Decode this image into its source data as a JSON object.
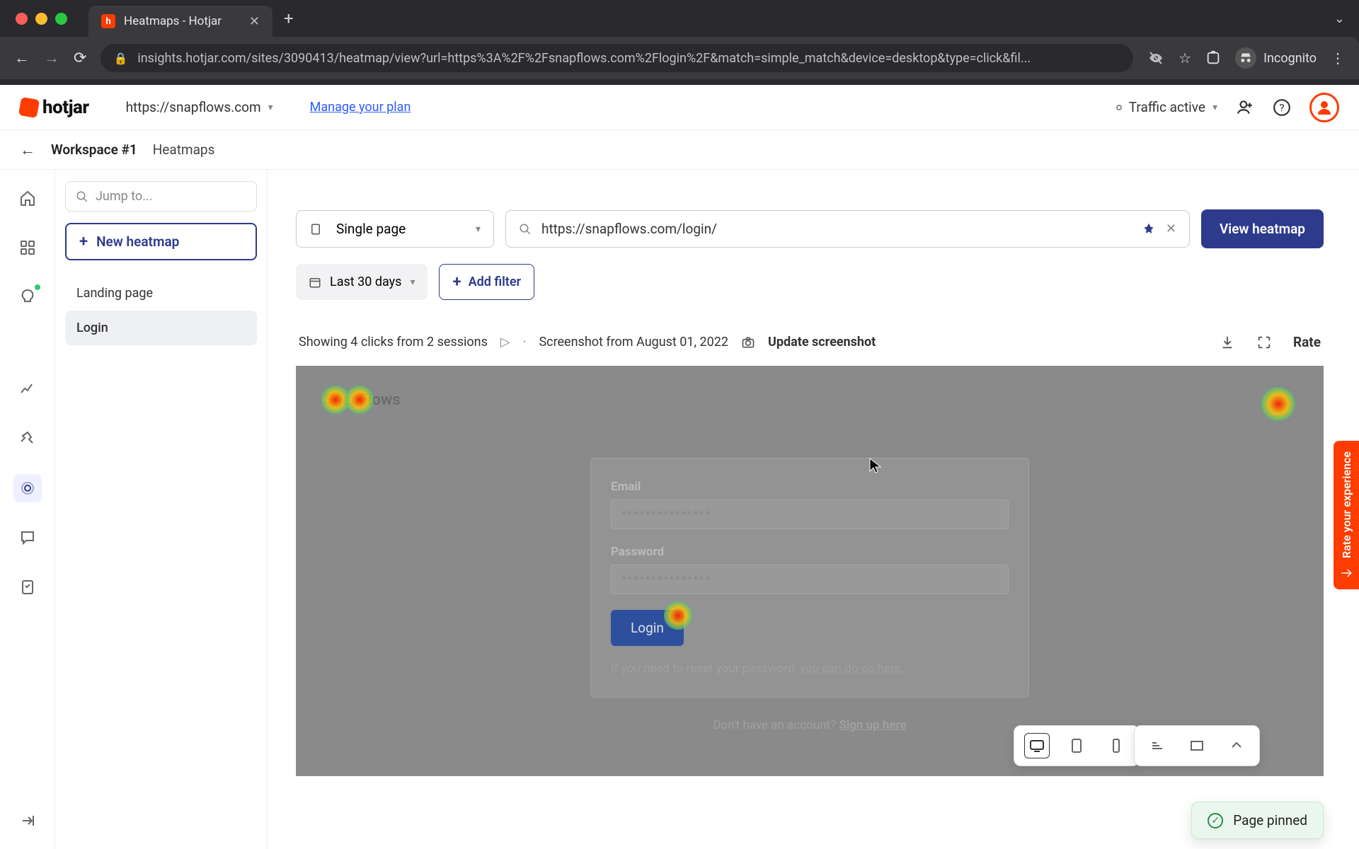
{
  "browser": {
    "tab_title": "Heatmaps - Hotjar",
    "url": "insights.hotjar.com/sites/3090413/heatmap/view?url=https%3A%2F%2Fsnapflows.com%2Flogin%2F&match=simple_match&device=desktop&type=click&fil...",
    "incognito": "Incognito"
  },
  "header": {
    "logo": "hotjar",
    "site": "https://snapflows.com",
    "manage_plan": "Manage your plan",
    "traffic": "Traffic active"
  },
  "breadcrumb": {
    "workspace": "Workspace #1",
    "section": "Heatmaps"
  },
  "sidebar": {
    "jump_placeholder": "Jump to...",
    "new_heatmap": "New heatmap",
    "items": [
      {
        "label": "Landing page",
        "active": false
      },
      {
        "label": "Login",
        "active": true
      }
    ]
  },
  "controls": {
    "page_mode": "Single page",
    "url_value": "https://snapflows.com/login/",
    "view_btn": "View heatmap",
    "date_range": "Last 30 days",
    "add_filter": "Add filter"
  },
  "info": {
    "summary": "Showing 4 clicks from 2 sessions",
    "screenshot": "Screenshot from August 01, 2022",
    "update": "Update screenshot",
    "rate": "Rate"
  },
  "viewer": {
    "brand": "SnapFlows",
    "email_label": "Email",
    "email_mask": "***************",
    "password_label": "Password",
    "password_mask": "***************",
    "login_btn": "Login",
    "reset_prefix": "If you need to reset your password, ",
    "reset_link": "you can do so here.",
    "signup_prefix": "Don't have an account? ",
    "signup_link": "Sign up here"
  },
  "feedback": {
    "label": "Rate your experience"
  },
  "toast": {
    "text": "Page pinned"
  }
}
